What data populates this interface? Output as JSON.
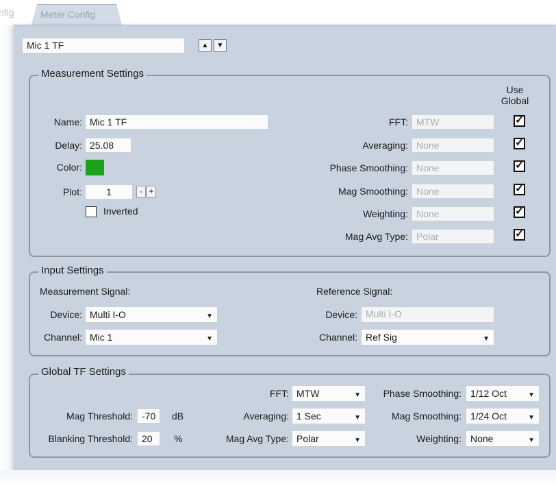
{
  "tabs": {
    "prev_label": "nfig",
    "active_label": "Meter Config"
  },
  "top": {
    "measurement_name": "Mic 1 TF"
  },
  "measurement_settings": {
    "title": "Measurement Settings",
    "use_global_header": [
      "Use",
      "Global"
    ],
    "name_label": "Name:",
    "name_value": "Mic 1 TF",
    "delay_label": "Delay:",
    "delay_value": "25.08",
    "color_label": "Color:",
    "color_value": "#1aa21a",
    "plot_label": "Plot:",
    "plot_value": "1",
    "minus": "-",
    "plus": "+",
    "inverted_label": "Inverted",
    "rows": [
      {
        "label": "FFT:",
        "value": "MTW"
      },
      {
        "label": "Averaging:",
        "value": "None"
      },
      {
        "label": "Phase Smoothing:",
        "value": "None"
      },
      {
        "label": "Mag Smoothing:",
        "value": "None"
      },
      {
        "label": "Weighting:",
        "value": "None"
      },
      {
        "label": "Mag Avg Type:",
        "value": "Polar"
      }
    ]
  },
  "input_settings": {
    "title": "Input Settings",
    "measurement_signal_label": "Measurement Signal:",
    "reference_signal_label": "Reference Signal:",
    "device_label": "Device:",
    "channel_label": "Channel:",
    "meas_device": "Multi I-O",
    "meas_channel": "Mic 1",
    "ref_device": "Multi I-O",
    "ref_channel": "Ref Sig"
  },
  "global_tf": {
    "title": "Global TF Settings",
    "mag_threshold_label": "Mag Threshold:",
    "mag_threshold_value": "-70",
    "mag_threshold_unit": "dB",
    "blanking_threshold_label": "Blanking Threshold:",
    "blanking_threshold_value": "20",
    "blanking_threshold_unit": "%",
    "fft_label": "FFT:",
    "fft_value": "MTW",
    "averaging_label": "Averaging:",
    "averaging_value": "1 Sec",
    "mag_avg_type_label": "Mag Avg Type:",
    "mag_avg_type_value": "Polar",
    "phase_smoothing_label": "Phase Smoothing:",
    "phase_smoothing_value": "1/12 Oct",
    "mag_smoothing_label": "Mag Smoothing:",
    "mag_smoothing_value": "1/24 Oct",
    "weighting_label": "Weighting:",
    "weighting_value": "None"
  }
}
